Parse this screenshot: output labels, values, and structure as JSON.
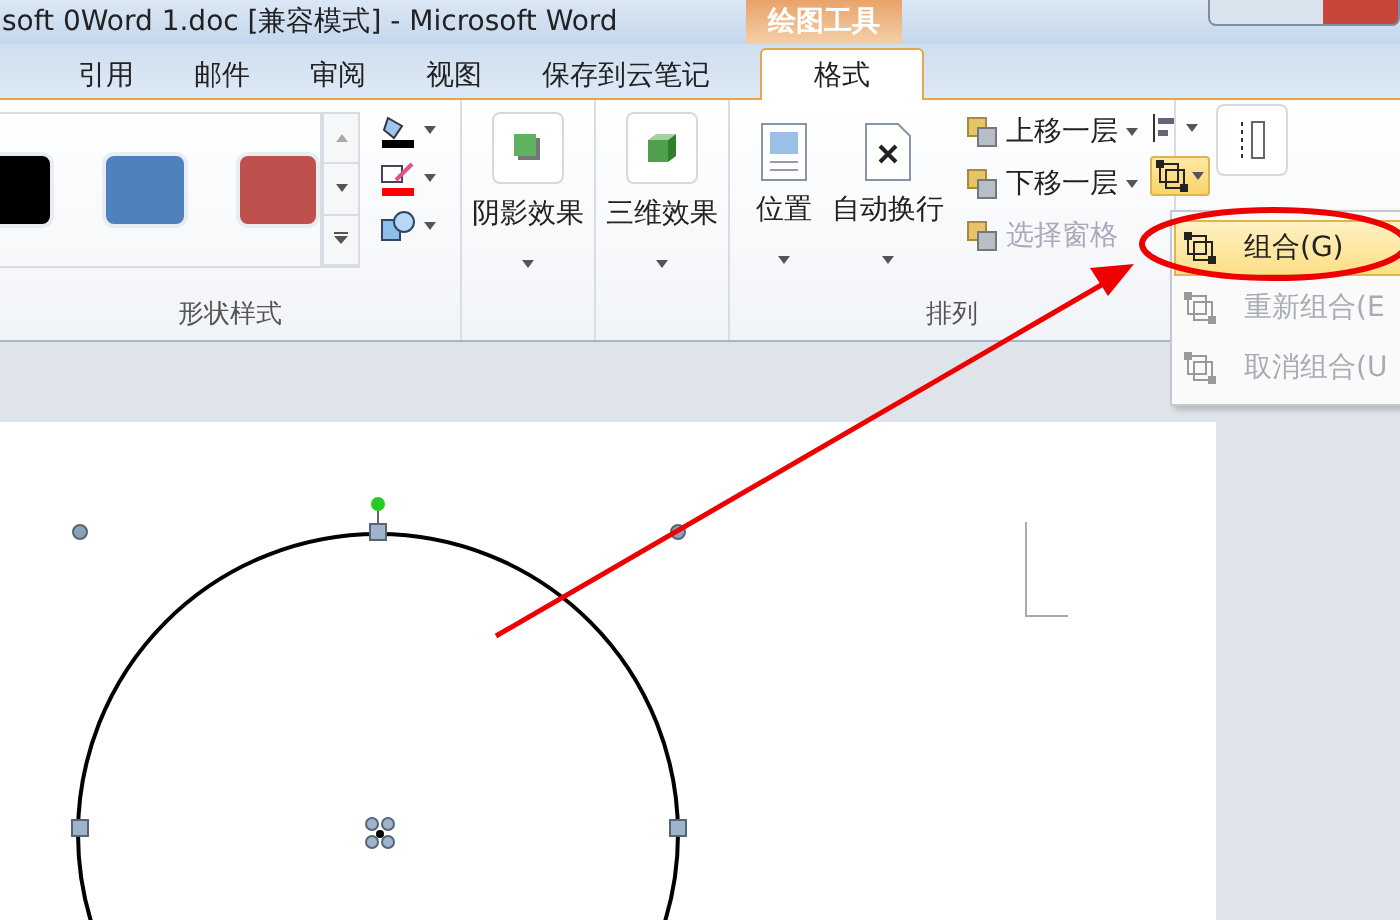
{
  "window": {
    "title": "soft 0Word 1.doc [兼容模式] - Microsoft Word",
    "contextual_tab": "绘图工具"
  },
  "tabs": [
    {
      "label": "引用",
      "selected": false
    },
    {
      "label": "邮件",
      "selected": false
    },
    {
      "label": "审阅",
      "selected": false
    },
    {
      "label": "视图",
      "selected": false
    },
    {
      "label": "保存到云笔记",
      "selected": false
    },
    {
      "label": "格式",
      "selected": true
    }
  ],
  "shape_styles": {
    "label": "形状样式",
    "swatches": [
      {
        "color": "#000000"
      },
      {
        "color": "#4f81bd"
      },
      {
        "color": "#c0504d"
      }
    ]
  },
  "effects": [
    {
      "label": "阴影效果",
      "kind": "shadow"
    },
    {
      "label": "三维效果",
      "kind": "cube"
    }
  ],
  "arrange": {
    "label": "排列",
    "large": [
      {
        "label": "位置",
        "kind": "position"
      },
      {
        "label": "自动换行",
        "kind": "wrap"
      }
    ],
    "small": [
      {
        "label": "上移一层",
        "disabled": false
      },
      {
        "label": "下移一层",
        "disabled": false
      },
      {
        "label": "选择窗格",
        "disabled": true
      }
    ]
  },
  "menu": [
    {
      "label": "组合(G)",
      "disabled": false,
      "selected": true
    },
    {
      "label": "重新组合(E",
      "disabled": true,
      "selected": false
    },
    {
      "label": "取消组合(U",
      "disabled": true,
      "selected": false
    }
  ]
}
